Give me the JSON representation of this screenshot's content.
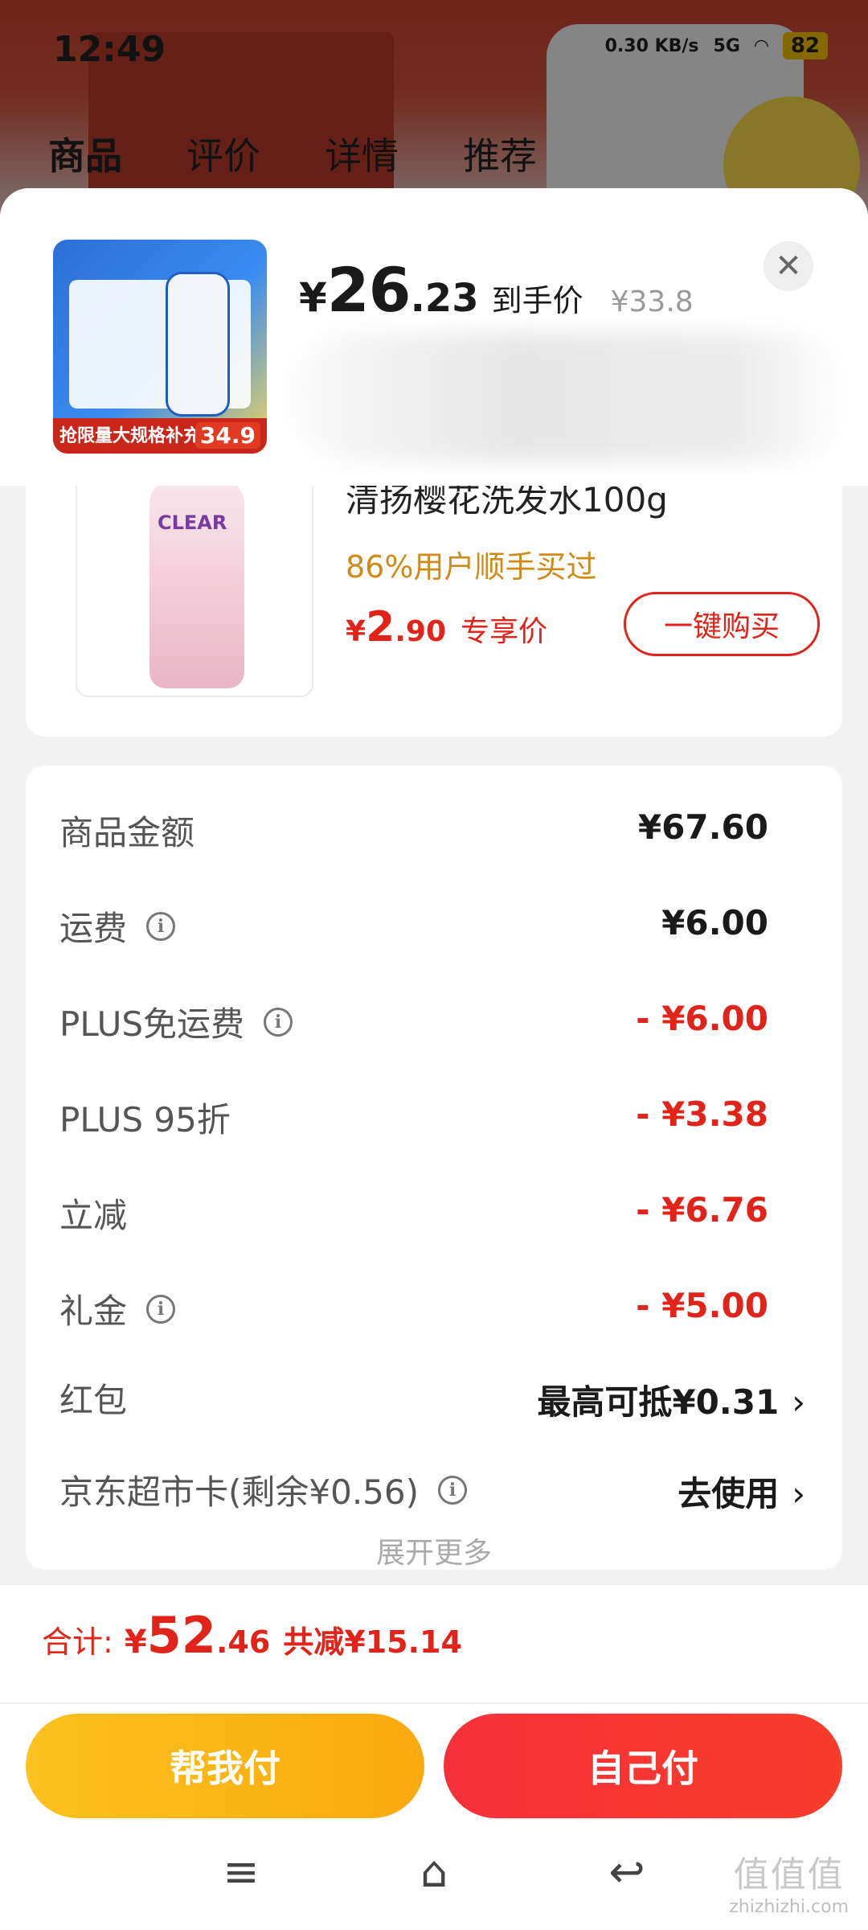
{
  "status_bar": {
    "time": "12:49",
    "net_speed": "0.30 KB/s",
    "network": "5G",
    "battery": "82"
  },
  "background_page": {
    "tabs": [
      "商品",
      "评价",
      "详情",
      "推荐"
    ],
    "active_tab": "商品"
  },
  "sheet": {
    "product_thumb": {
      "caption": "抢限量大规格补充装",
      "price": "34.9"
    },
    "price": {
      "symbol": "¥",
      "integer": "26",
      "decimal": ".23",
      "tag": "到手价",
      "original": "¥33.8"
    },
    "close_icon": "close-icon"
  },
  "recommend": {
    "title": "清扬樱花洗发水100g",
    "bought_stat": "86%用户顺手买过",
    "price_symbol": "¥",
    "price_integer": "2",
    "price_decimal": ".90",
    "price_tag": "专享价",
    "buy_label": "一键购买",
    "bottle_brand": "CLEAR"
  },
  "fees": [
    {
      "label": "商品金额",
      "value": "¥67.60",
      "info": false,
      "style": "normal"
    },
    {
      "label": "运费",
      "value": "¥6.00",
      "info": true,
      "style": "normal"
    },
    {
      "label": "PLUS免运费",
      "value": "- ¥6.00",
      "info": true,
      "style": "red"
    },
    {
      "label": "PLUS 95折",
      "value": "- ¥3.38",
      "info": false,
      "style": "red"
    },
    {
      "label": "立减",
      "value": "- ¥6.76",
      "info": false,
      "style": "red"
    },
    {
      "label": "礼金",
      "value": "- ¥5.00",
      "info": true,
      "style": "red"
    },
    {
      "label": "红包",
      "value": "最高可抵¥0.31",
      "info": false,
      "style": "link"
    },
    {
      "label": "京东超市卡(剩余¥0.56)",
      "value": "去使用",
      "info": true,
      "style": "link"
    }
  ],
  "expand_more": "展开更多",
  "total": {
    "label": "合计:",
    "symbol": "¥",
    "integer": "52",
    "decimal": ".46",
    "saved": "共减¥15.14"
  },
  "buttons": {
    "help_pay": "帮我付",
    "self_pay": "自己付"
  },
  "nav": {
    "menu": "≡",
    "home": "⌂",
    "back": "↩"
  },
  "watermark": {
    "big": "值值值",
    "small": "zhizhizhi.com"
  },
  "colors": {
    "accent_red": "#e2231a",
    "help_pay_yellow": "#f9a90e",
    "self_pay_red": "#f6303a",
    "stat_orange": "#d08a1a"
  }
}
